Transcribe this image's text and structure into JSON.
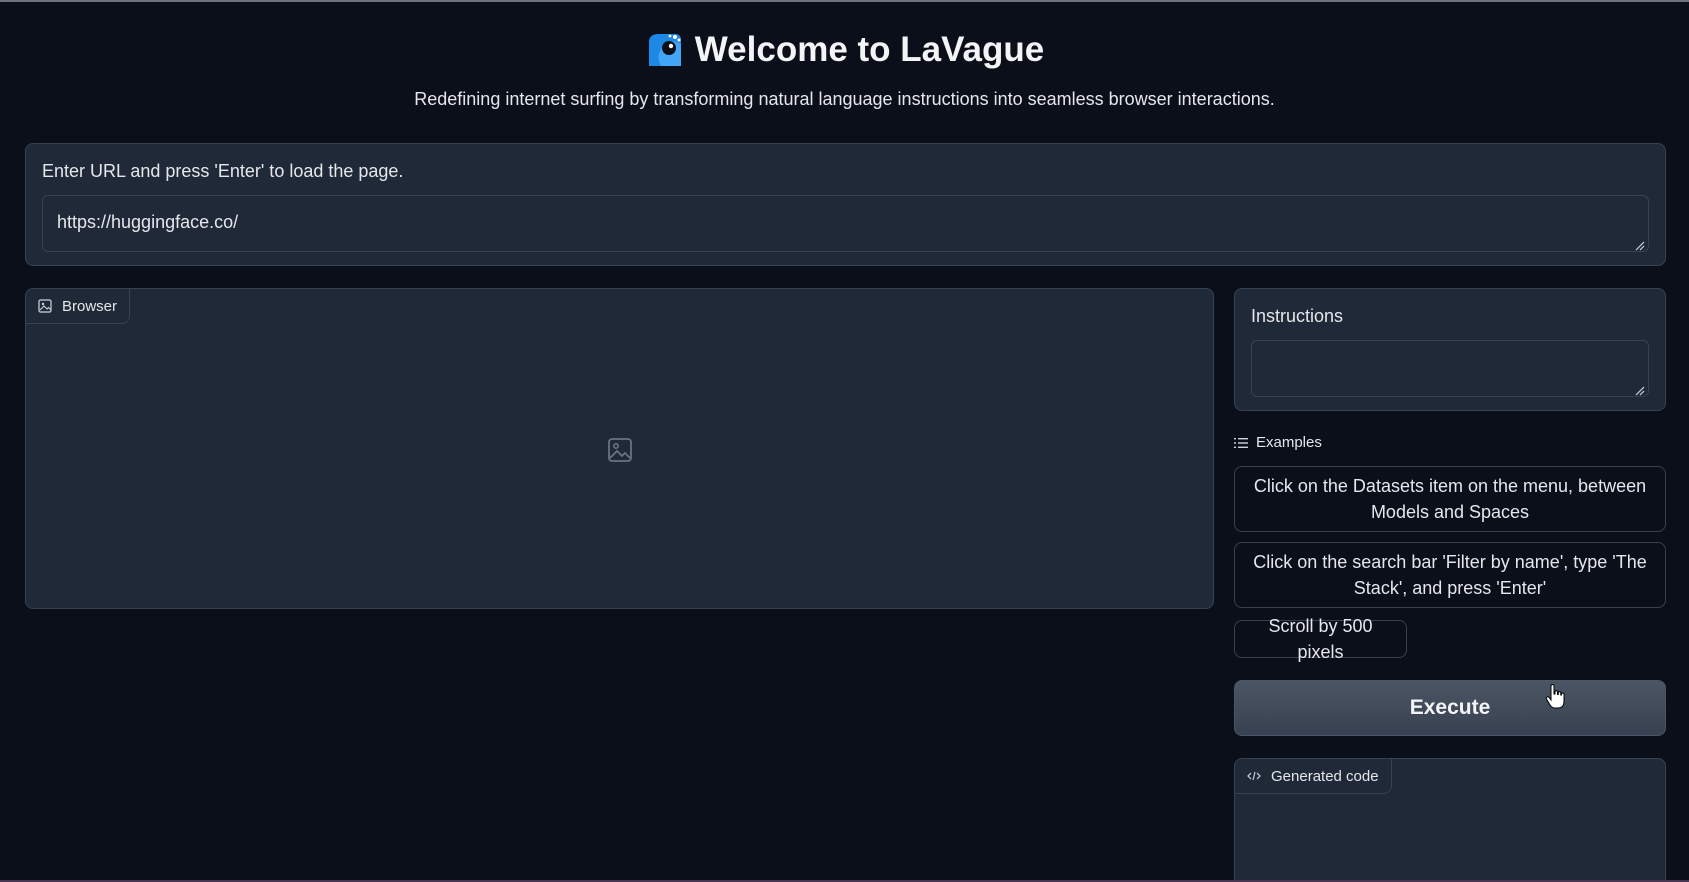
{
  "header": {
    "title": "Welcome to LaVague",
    "subtitle": "Redefining internet surfing by transforming natural language instructions into seamless browser interactions."
  },
  "url_panel": {
    "label": "Enter URL and press 'Enter' to load the page.",
    "value": "https://huggingface.co/"
  },
  "browser": {
    "tab_label": "Browser",
    "icon": "image-icon"
  },
  "instructions": {
    "label": "Instructions",
    "value": ""
  },
  "examples": {
    "label": "Examples",
    "items": [
      "Click on the Datasets item on the menu, between Models and Spaces",
      "Click on the search bar 'Filter by name', type 'The Stack', and press 'Enter'",
      "Scroll by 500 pixels"
    ]
  },
  "execute": {
    "label": "Execute"
  },
  "generated_code": {
    "tab_label": "Generated code",
    "icon": "code-icon"
  },
  "colors": {
    "background": "#0b0f19",
    "panel": "#1f2937",
    "border": "#374151",
    "logo_blue": "#1e88e5"
  }
}
